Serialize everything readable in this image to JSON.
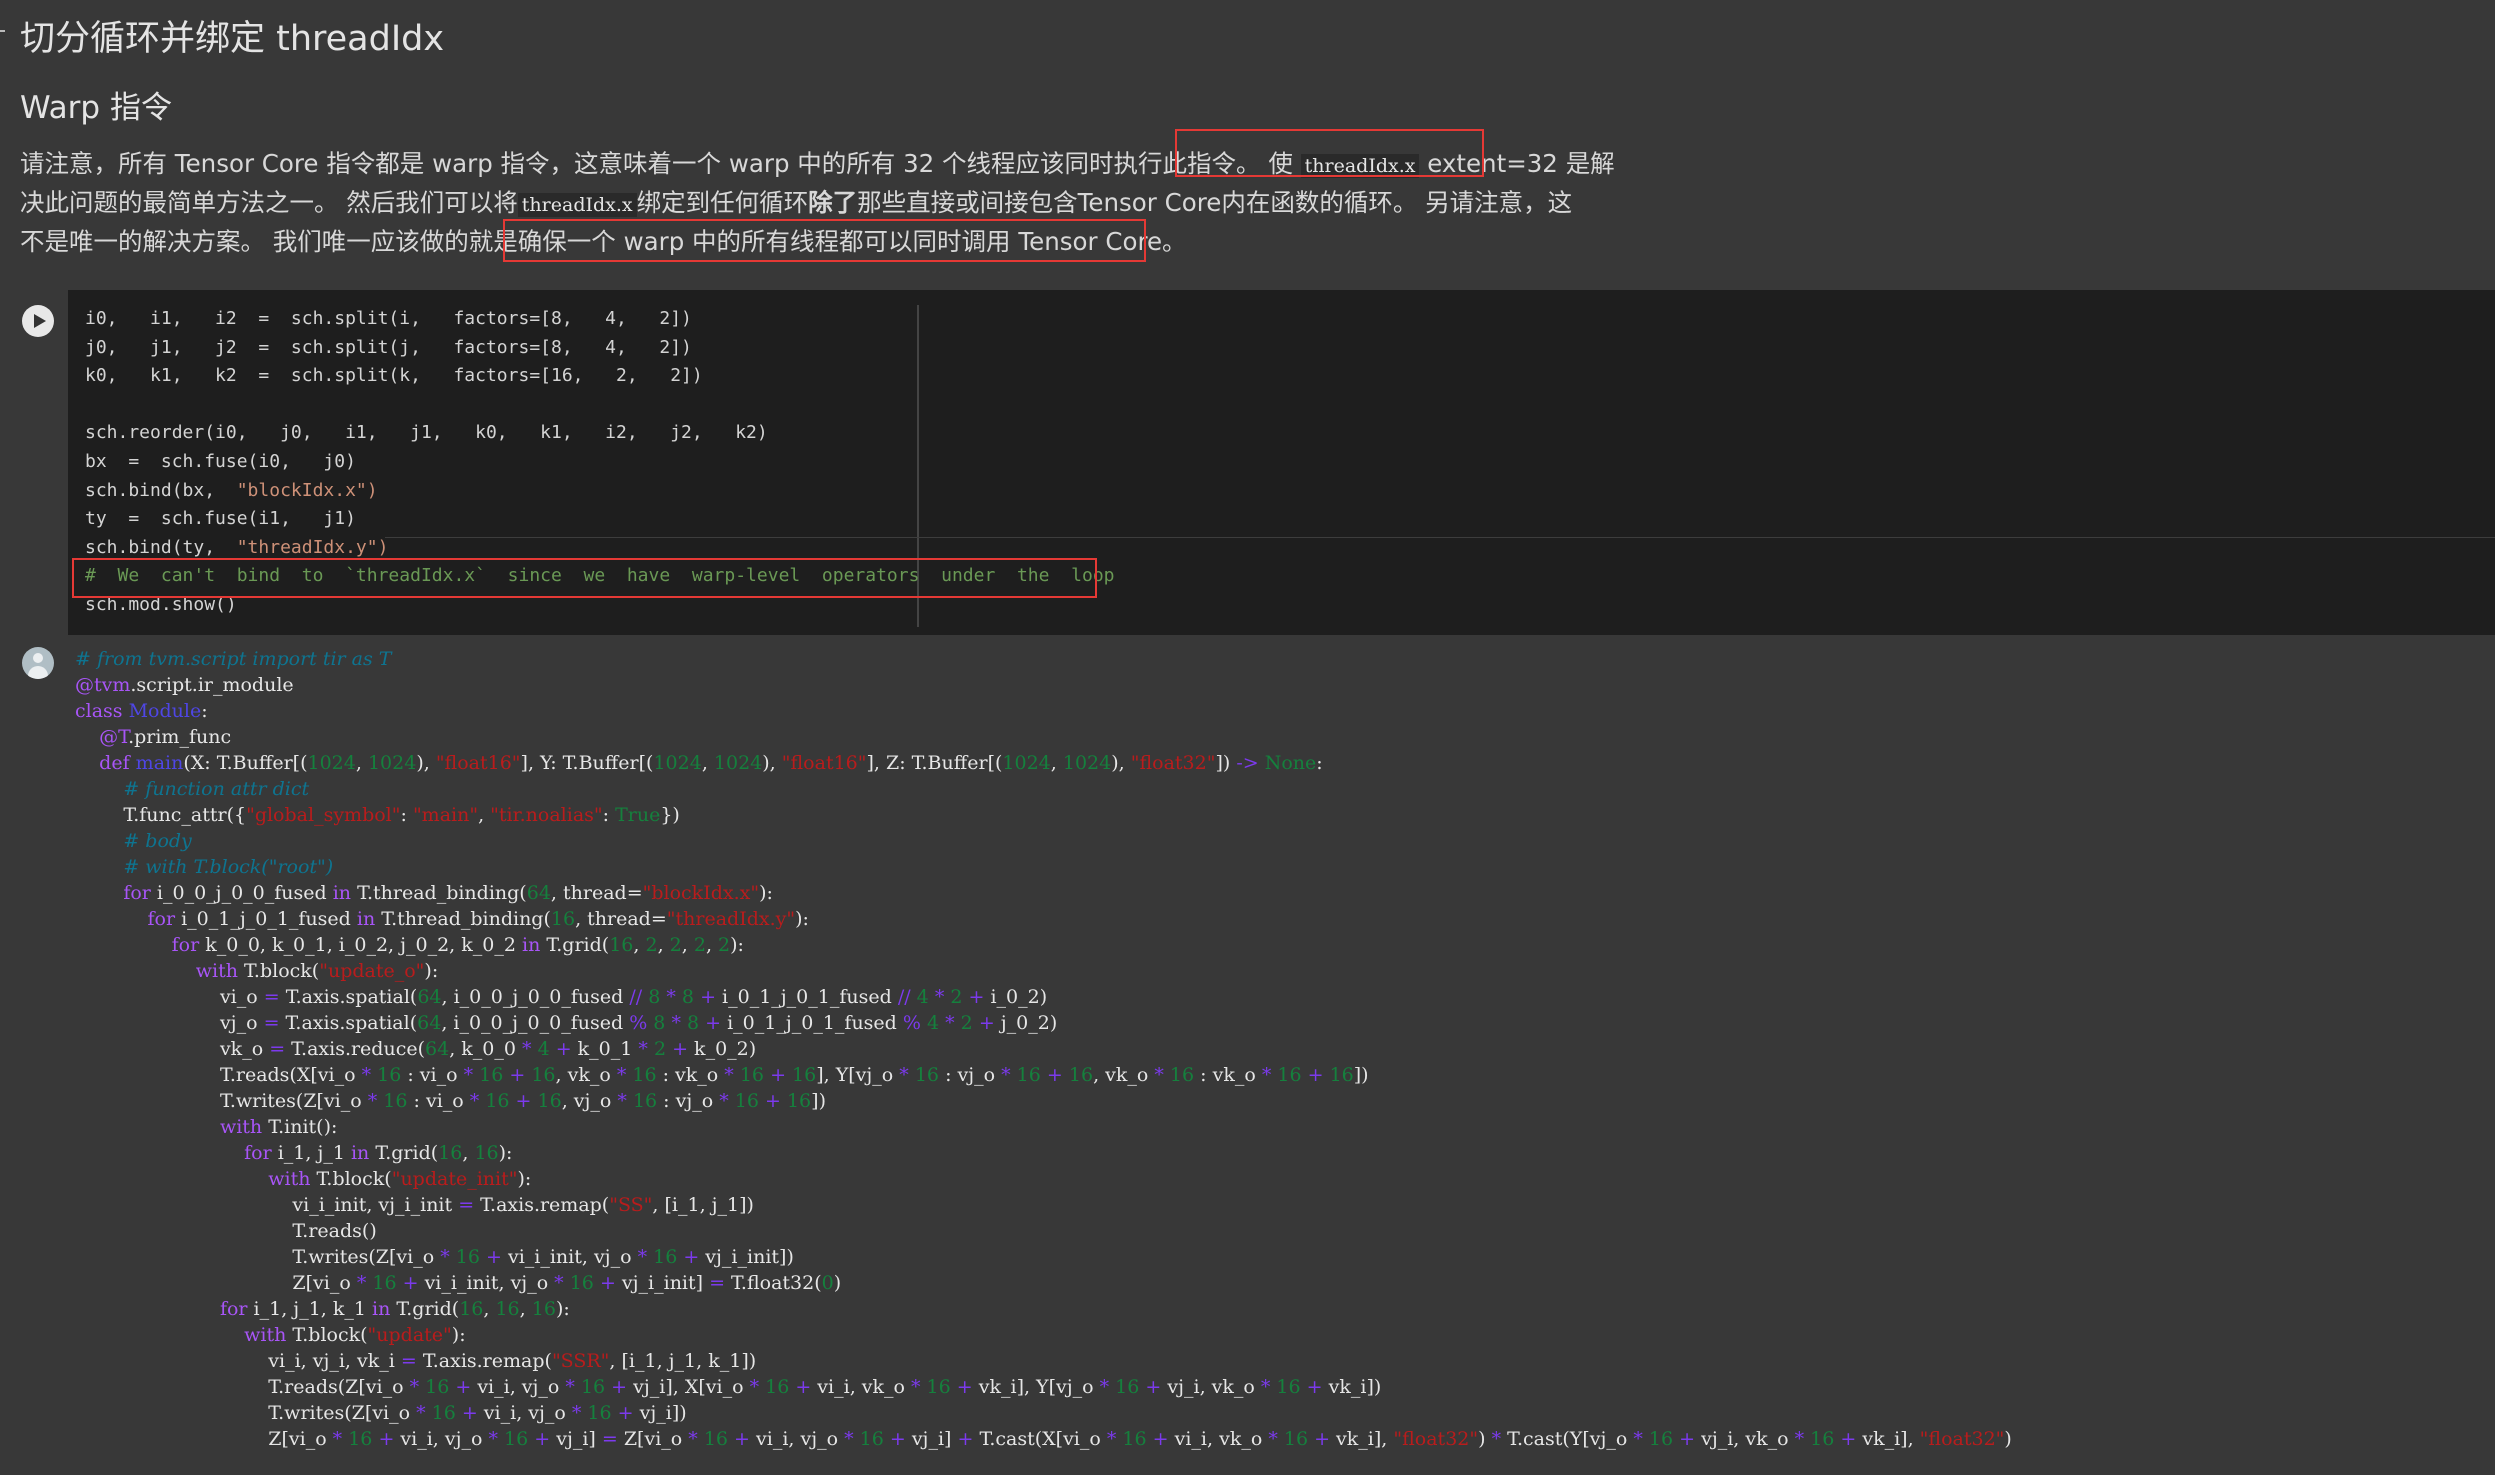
{
  "markdown": {
    "title": "切分循环并绑定 threadIdx",
    "subtitle": "Warp 指令",
    "para": {
      "l1_a": "请注意，所有 Tensor Core 指令都是 warp 指令，这意味着一个 warp 中的所有 32 个线程应该同时执行此指令。 使 ",
      "l1_code": "threadIdx.x",
      "l1_b": " extent=32 是解",
      "l2_a": "决此问题的最简单方法之一。 然后我们可以将",
      "l2_code": "threadIdx.x",
      "l2_b": "绑定到任何循环",
      "l2_bold": "除了",
      "l2_c": "那些直接或间接包含Tensor Core内在函数的循环。 另请注意，这",
      "l3_a": "不是唯一的解决方案。 我们唯一应该做的就是",
      "l3_b": "确保一个 warp 中的所有线程都可以同时调用 Tensor Core。"
    }
  },
  "code_cell": {
    "lines": [
      "i0,   i1,   i2  =  sch.split(i,   factors=[8,   4,   2])",
      "j0,   j1,   j2  =  sch.split(j,   factors=[8,   4,   2])",
      "k0,   k1,   k2  =  sch.split(k,   factors=[16,   2,   2])",
      "",
      "sch.reorder(i0,   j0,   i1,   j1,   k0,   k1,   i2,   j2,   k2)",
      "bx  =  sch.fuse(i0,   j0)",
      "sch.bind(bx,  ",
      "ty  =  sch.fuse(i1,   j1)",
      "sch.bind(ty,  ",
      "",
      "sch.mod.show()"
    ],
    "str_block": "\"blockIdx.x\")",
    "str_thread": "\"threadIdx.y\")",
    "comment": "#  We  can't  bind  to  `threadIdx.x`  since  we  have  warp-level  operators  under  the  loop"
  }
}
